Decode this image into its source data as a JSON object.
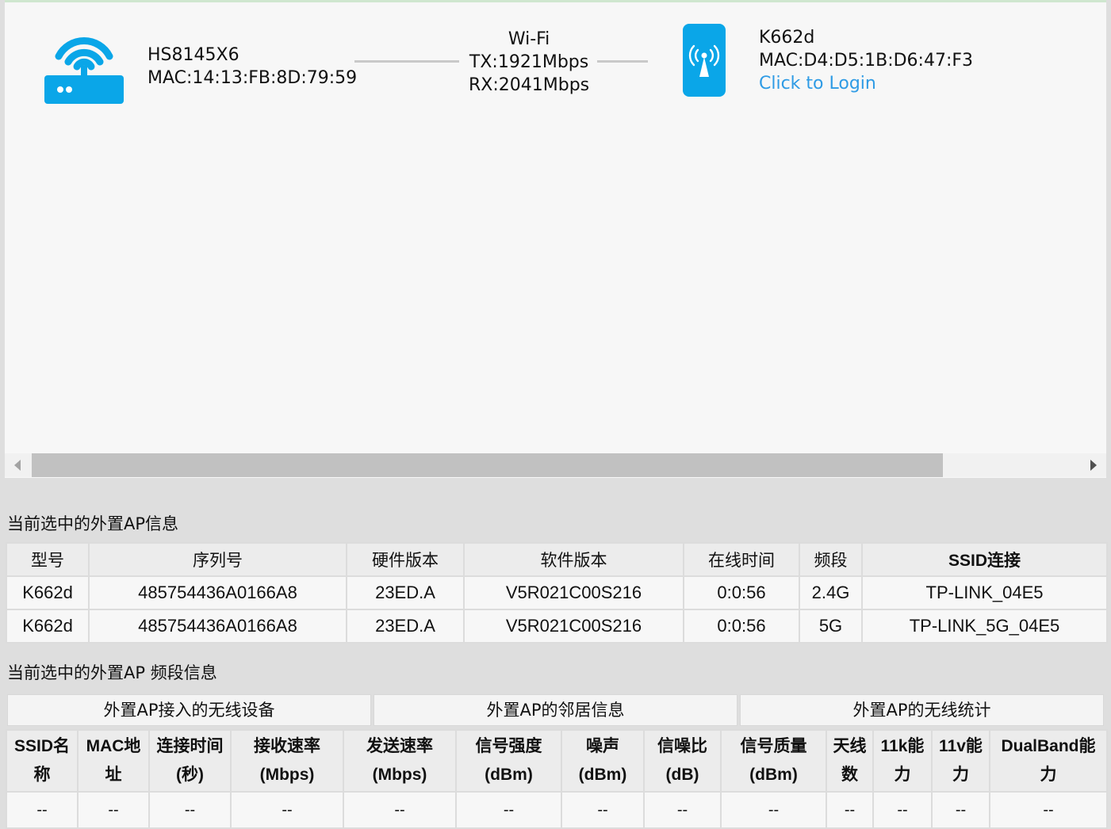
{
  "topology": {
    "gateway": {
      "model": "HS8145X6",
      "mac": "MAC:14:13:FB:8D:79:59"
    },
    "link": {
      "type": "Wi-Fi",
      "tx": "TX:1921Mbps",
      "rx": "RX:2041Mbps"
    },
    "ap": {
      "model": "K662d",
      "mac": "MAC:D4:D5:1B:D6:47:F3",
      "login": "Click to Login"
    }
  },
  "ap_info": {
    "title": "当前选中的外置AP信息",
    "headers": [
      "型号",
      "序列号",
      "硬件版本",
      "软件版本",
      "在线时间",
      "频段",
      "SSID连接"
    ],
    "rows": [
      [
        "K662d",
        "485754436A0166A8",
        "23ED.A",
        "V5R021C00S216",
        "0:0:56",
        "2.4G",
        "TP-LINK_04E5"
      ],
      [
        "K662d",
        "485754436A0166A8",
        "23ED.A",
        "V5R021C00S216",
        "0:0:56",
        "5G",
        "TP-LINK_5G_04E5"
      ]
    ]
  },
  "band_info": {
    "title": "当前选中的外置AP 频段信息",
    "tabs": [
      "外置AP接入的无线设备",
      "外置AP的邻居信息",
      "外置AP的无线统计"
    ],
    "headers": [
      [
        "SSID名",
        "称"
      ],
      [
        "MAC地",
        "址"
      ],
      [
        "连接时间",
        "(秒)"
      ],
      [
        "接收速率",
        "(Mbps)"
      ],
      [
        "发送速率",
        "(Mbps)"
      ],
      [
        "信号强度",
        "(dBm)"
      ],
      [
        "噪声",
        "(dBm)"
      ],
      [
        "信噪比",
        "(dB)"
      ],
      [
        "信号质量",
        "(dBm)"
      ],
      [
        "天线",
        "数"
      ],
      [
        "11k能",
        "力"
      ],
      [
        "11v能",
        "力"
      ],
      [
        "DualBand能",
        "力"
      ]
    ],
    "row": [
      "--",
      "--",
      "--",
      "--",
      "--",
      "--",
      "--",
      "--",
      "--",
      "--",
      "--",
      "--",
      "--"
    ]
  },
  "colors": {
    "accent": "#0aa6e8",
    "link": "#2e9be5"
  }
}
